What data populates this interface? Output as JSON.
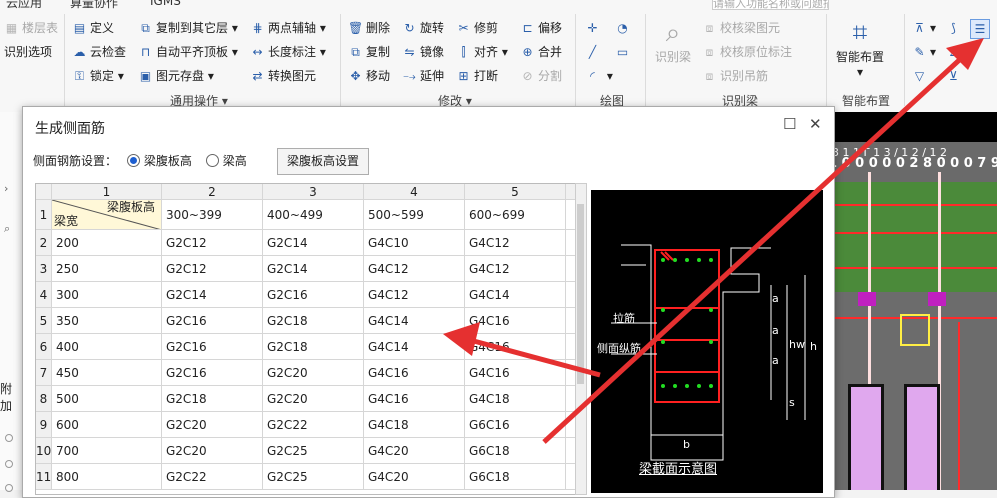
{
  "ribbon": {
    "top_items": [
      "云应用",
      "算量协作",
      "IGMS"
    ],
    "search_placeholder": "请输入功能名称或问题描述",
    "buttons": {
      "floor_table": "楼层表",
      "recognize_options": "识别选项",
      "define": "定义",
      "cloud_check": "云检查",
      "lock": "锁定",
      "copy_to_other_floor": "复制到其它层",
      "auto_flat_slab": "自动平齐顶板",
      "element_save": "图元存盘",
      "two_point_axis": "两点辅轴",
      "length_dimension": "长度标注",
      "convert_element": "转换图元",
      "delete": "删除",
      "copy": "复制",
      "move": "移动",
      "rotate": "旋转",
      "mirror": "镜像",
      "extend": "延伸",
      "trim": "修剪",
      "align": "对齐",
      "break": "打断",
      "offset": "偏移",
      "merge": "合并",
      "split": "分割",
      "recognize_beam": "识别梁",
      "check_beam_element": "校核梁图元",
      "check_origin_dim": "校核原位标注",
      "recognize_hanger": "识别吊筋",
      "smart_layout": "智能布置"
    },
    "groups": {
      "general_ops": "通用操作",
      "modify": "修改",
      "draw": "绘图",
      "recognize_beam": "识别梁",
      "smart_layout": "智能布置"
    }
  },
  "left_pane": {
    "attach_label": "附加"
  },
  "canvas": {
    "dimension_text": "3 1 1 Γ 1 3 / 1 2 / 1 2",
    "number_text": "1 0 0 0 0 0 2 8 0 0 0 7 9 0"
  },
  "dialog": {
    "title": "生成侧面筋",
    "setting_label": "侧面钢筋设置：",
    "radio_web_height": "梁腹板高",
    "radio_beam_height": "梁高",
    "btn_web_height_setting": "梁腹板高设置",
    "table": {
      "col_numbers": [
        "1",
        "2",
        "3",
        "4",
        "5"
      ],
      "diag_top": "梁腹板高",
      "diag_bottom": "梁宽",
      "header_ranges": [
        "300~399",
        "400~499",
        "500~599",
        "600~699"
      ],
      "rows": [
        {
          "num": "2",
          "width": "200",
          "c1": "G2C12",
          "c2": "G2C14",
          "c3": "G4C10",
          "c4": "G4C12"
        },
        {
          "num": "3",
          "width": "250",
          "c1": "G2C12",
          "c2": "G2C14",
          "c3": "G4C12",
          "c4": "G4C12"
        },
        {
          "num": "4",
          "width": "300",
          "c1": "G2C14",
          "c2": "G2C16",
          "c3": "G4C12",
          "c4": "G4C14"
        },
        {
          "num": "5",
          "width": "350",
          "c1": "G2C16",
          "c2": "G2C18",
          "c3": "G4C14",
          "c4": "G4C16"
        },
        {
          "num": "6",
          "width": "400",
          "c1": "G2C16",
          "c2": "G2C18",
          "c3": "G4C14",
          "c4": "G4C16"
        },
        {
          "num": "7",
          "width": "450",
          "c1": "G2C16",
          "c2": "G2C20",
          "c3": "G4C16",
          "c4": "G4C16"
        },
        {
          "num": "8",
          "width": "500",
          "c1": "G2C18",
          "c2": "G2C20",
          "c3": "G4C16",
          "c4": "G4C18"
        },
        {
          "num": "9",
          "width": "600",
          "c1": "G2C20",
          "c2": "G2C22",
          "c3": "G4C18",
          "c4": "G6C16"
        },
        {
          "num": "10",
          "width": "700",
          "c1": "G2C20",
          "c2": "G2C25",
          "c3": "G4C20",
          "c4": "G6C18"
        },
        {
          "num": "11",
          "width": "800",
          "c1": "G2C22",
          "c2": "G2C25",
          "c3": "G4C20",
          "c4": "G6C18"
        }
      ]
    },
    "preview": {
      "label_tie": "拉筋",
      "label_side": "侧面纵筋",
      "label_a": "a",
      "label_hw": "hw",
      "label_h": "h",
      "label_s": "s",
      "label_b": "b",
      "caption": "梁截面示意图"
    }
  },
  "colors": {
    "arrow": "#e53030",
    "accent": "#1e5fd0",
    "rebar_red": "#ff2020",
    "rebar_green": "#22dd22"
  }
}
